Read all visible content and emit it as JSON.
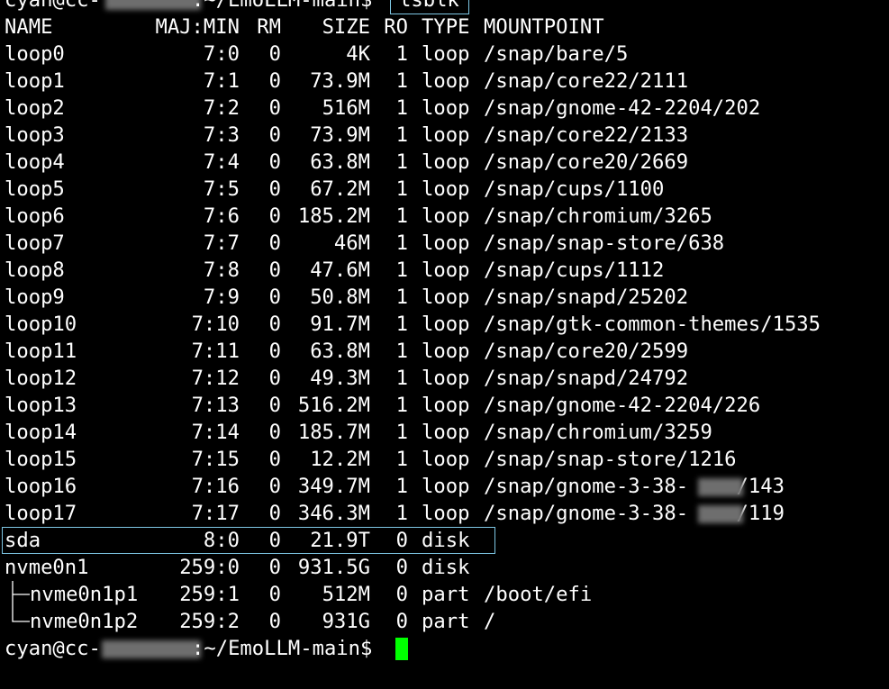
{
  "prompt_top": {
    "prefix": "cyan@cc-",
    "hidden": "XXXXXXX",
    "path": ":~/EmoLLM-main$",
    "command": "lsblk"
  },
  "header": [
    "NAME",
    "MAJ:MIN",
    "RM",
    "SIZE",
    "RO",
    "TYPE",
    "MOUNTPOINT"
  ],
  "rows": [
    {
      "name": "loop0",
      "majmin": "7:0",
      "rm": "0",
      "size": "4K",
      "ro": "1",
      "type": "loop",
      "mount": "/snap/bare/5"
    },
    {
      "name": "loop1",
      "majmin": "7:1",
      "rm": "0",
      "size": "73.9M",
      "ro": "1",
      "type": "loop",
      "mount": "/snap/core22/2111"
    },
    {
      "name": "loop2",
      "majmin": "7:2",
      "rm": "0",
      "size": "516M",
      "ro": "1",
      "type": "loop",
      "mount": "/snap/gnome-42-2204/202"
    },
    {
      "name": "loop3",
      "majmin": "7:3",
      "rm": "0",
      "size": "73.9M",
      "ro": "1",
      "type": "loop",
      "mount": "/snap/core22/2133"
    },
    {
      "name": "loop4",
      "majmin": "7:4",
      "rm": "0",
      "size": "63.8M",
      "ro": "1",
      "type": "loop",
      "mount": "/snap/core20/2669"
    },
    {
      "name": "loop5",
      "majmin": "7:5",
      "rm": "0",
      "size": "67.2M",
      "ro": "1",
      "type": "loop",
      "mount": "/snap/cups/1100"
    },
    {
      "name": "loop6",
      "majmin": "7:6",
      "rm": "0",
      "size": "185.2M",
      "ro": "1",
      "type": "loop",
      "mount": "/snap/chromium/3265"
    },
    {
      "name": "loop7",
      "majmin": "7:7",
      "rm": "0",
      "size": "46M",
      "ro": "1",
      "type": "loop",
      "mount": "/snap/snap-store/638"
    },
    {
      "name": "loop8",
      "majmin": "7:8",
      "rm": "0",
      "size": "47.6M",
      "ro": "1",
      "type": "loop",
      "mount": "/snap/cups/1112"
    },
    {
      "name": "loop9",
      "majmin": "7:9",
      "rm": "0",
      "size": "50.8M",
      "ro": "1",
      "type": "loop",
      "mount": "/snap/snapd/25202"
    },
    {
      "name": "loop10",
      "majmin": "7:10",
      "rm": "0",
      "size": "91.7M",
      "ro": "1",
      "type": "loop",
      "mount": "/snap/gtk-common-themes/1535"
    },
    {
      "name": "loop11",
      "majmin": "7:11",
      "rm": "0",
      "size": "63.8M",
      "ro": "1",
      "type": "loop",
      "mount": "/snap/core20/2599"
    },
    {
      "name": "loop12",
      "majmin": "7:12",
      "rm": "0",
      "size": "49.3M",
      "ro": "1",
      "type": "loop",
      "mount": "/snap/snapd/24792"
    },
    {
      "name": "loop13",
      "majmin": "7:13",
      "rm": "0",
      "size": "516.2M",
      "ro": "1",
      "type": "loop",
      "mount": "/snap/gnome-42-2204/226"
    },
    {
      "name": "loop14",
      "majmin": "7:14",
      "rm": "0",
      "size": "185.7M",
      "ro": "1",
      "type": "loop",
      "mount": "/snap/chromium/3259"
    },
    {
      "name": "loop15",
      "majmin": "7:15",
      "rm": "0",
      "size": "12.2M",
      "ro": "1",
      "type": "loop",
      "mount": "/snap/snap-store/1216"
    },
    {
      "name": "loop16",
      "majmin": "7:16",
      "rm": "0",
      "size": "349.7M",
      "ro": "1",
      "type": "loop",
      "mount": "/snap/gnome-3-38-XXXX/143"
    },
    {
      "name": "loop17",
      "majmin": "7:17",
      "rm": "0",
      "size": "346.3M",
      "ro": "1",
      "type": "loop",
      "mount": "/snap/gnome-3-38-XXXX/119"
    },
    {
      "name": "sda",
      "majmin": "8:0",
      "rm": "0",
      "size": "21.9T",
      "ro": "0",
      "type": "disk",
      "mount": ""
    },
    {
      "name": "nvme0n1",
      "majmin": "259:0",
      "rm": "0",
      "size": "931.5G",
      "ro": "0",
      "type": "disk",
      "mount": ""
    },
    {
      "name": "nvme0n1p1",
      "majmin": "259:1",
      "rm": "0",
      "size": "512M",
      "ro": "0",
      "type": "part",
      "mount": "/boot/efi"
    },
    {
      "name": "nvme0n1p2",
      "majmin": "259:2",
      "rm": "0",
      "size": "931G",
      "ro": "0",
      "type": "part",
      "mount": "/"
    }
  ],
  "prompt_bottom": {
    "prefix": "cyan@cc-",
    "hidden": "XXXXXXX",
    "path": ":~/EmoLLM-main$"
  },
  "colors": {
    "background": "#000000",
    "text": "#ffffff",
    "highlight_border": "#7ec7e4",
    "cursor": "#00ff00"
  }
}
